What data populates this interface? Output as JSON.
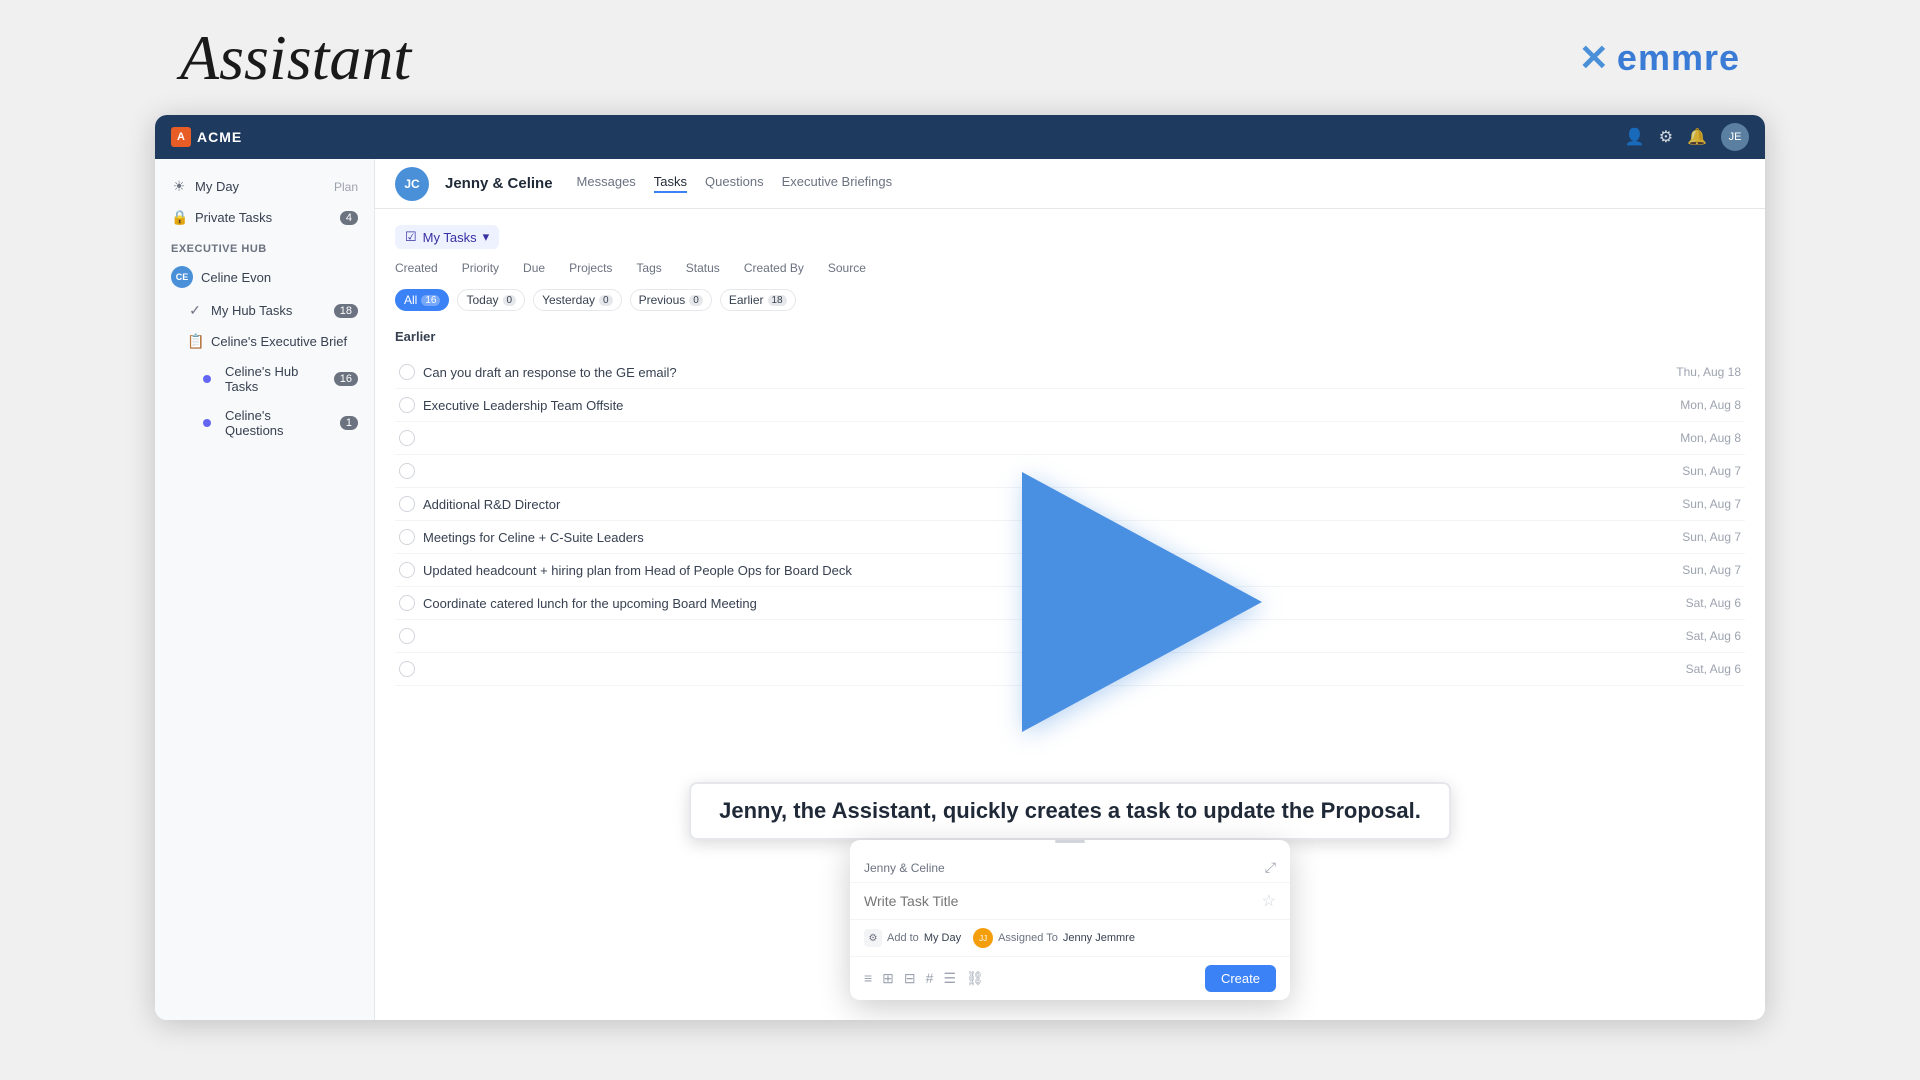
{
  "outer": {
    "assistant_title": "Assistant",
    "emmre_logo_x": "✕",
    "emmre_logo_text": "emmre"
  },
  "nav": {
    "logo_text": "ACME",
    "logo_icon": "A"
  },
  "sidebar": {
    "my_day": "My Day",
    "my_day_action": "Plan",
    "private_tasks": "Private Tasks",
    "private_tasks_count": "4",
    "executive_hub": "Executive Hub",
    "celine_evon": "Celine Evon",
    "celine_initials": "CE",
    "my_hub_tasks": "My Hub Tasks",
    "my_hub_tasks_count": "18",
    "celines_executive_brief": "Celine's Executive Brief",
    "celines_hub_tasks": "Celine's Hub Tasks",
    "celines_hub_tasks_count": "16",
    "celines_questions": "Celine's Questions",
    "celines_questions_count": "1"
  },
  "header": {
    "title": "Jenny & Celine",
    "avatar_initials": "JC",
    "tabs": [
      "Messages",
      "Tasks",
      "Questions",
      "Executive Briefings"
    ],
    "active_tab": "Tasks"
  },
  "tasks": {
    "dropdown_label": "My Tasks",
    "filters": {
      "created": "Created",
      "priority": "Priority",
      "due": "Due",
      "projects": "Projects",
      "tags": "Tags",
      "status": "Status",
      "created_by": "Created By",
      "source": "Source"
    },
    "filter_buttons": [
      {
        "label": "All",
        "count": "16",
        "active": true
      },
      {
        "label": "Today",
        "count": "0",
        "active": false
      },
      {
        "label": "Yesterday",
        "count": "0",
        "active": false
      },
      {
        "label": "Previous",
        "count": "0",
        "active": false
      },
      {
        "label": "Earlier",
        "count": "18",
        "active": false
      }
    ],
    "section": "Earlier",
    "task_rows": [
      {
        "text": "Can you draft an response to the GE email?",
        "date": "Thu, Aug 18"
      },
      {
        "text": "Executive Leadership Team Offsite",
        "date": "Mon, Aug 8"
      },
      {
        "text": "",
        "date": "Mon, Aug 8"
      },
      {
        "text": "",
        "date": "Sun, Aug 7"
      },
      {
        "text": "Additional R&D Director",
        "date": "Sun, Aug 7"
      },
      {
        "text": "Meetings for Celine + C-Suite Leaders",
        "date": "Sun, Aug 7"
      },
      {
        "text": "Updated headcount + hiring plan from Head of People Ops for Board Deck",
        "date": "Sun, Aug 7"
      },
      {
        "text": "Coordinate catered lunch for the upcoming Board Meeting",
        "date": "Sat, Aug 6"
      },
      {
        "text": "",
        "date": "Sat, Aug 6"
      },
      {
        "text": "",
        "date": "Sat, Aug 6"
      }
    ]
  },
  "caption": {
    "text": "Jenny, the Assistant, quickly creates a task to update the Proposal."
  },
  "modal": {
    "title": "Jenny & Celine",
    "input_placeholder": "Write Task Title",
    "add_to_label": "Add to",
    "add_to_value": "My Day",
    "assigned_to_label": "Assigned To",
    "assigned_to_value": "Jenny Jemmre",
    "create_btn": "Create"
  }
}
